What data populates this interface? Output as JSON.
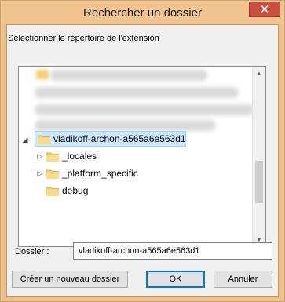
{
  "window": {
    "title": "Rechercher un dossier",
    "close_glyph": "✕"
  },
  "dialog": {
    "instruction": "Sélectionner le répertoire de l'extension"
  },
  "tree": {
    "selected": {
      "label": "vladikoff-archon-a565a6e563d1",
      "expander": "◢"
    },
    "children": [
      {
        "label": "_locales",
        "expander": "▷"
      },
      {
        "label": "_platform_specific",
        "expander": "▷"
      },
      {
        "label": "debug",
        "expander": ""
      }
    ]
  },
  "scrollbar": {
    "up_arrow": "▲",
    "down_arrow": "▼"
  },
  "folder_field": {
    "label": "Dossier :",
    "value": "vladikoff-archon-a565a6e563d1"
  },
  "buttons": {
    "new_folder": "Créer un nouveau dossier",
    "ok": "OK",
    "cancel": "Annuler"
  },
  "colors": {
    "title_bar": "#f2c48f",
    "close_button": "#c7503f",
    "selection": "#cce8ff",
    "folder": "#f2cf73"
  }
}
